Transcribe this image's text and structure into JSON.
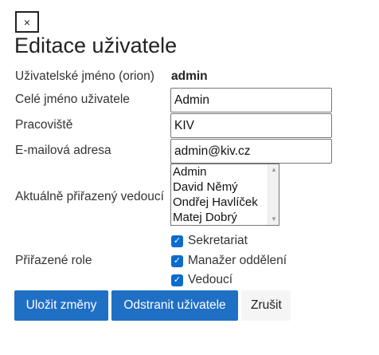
{
  "close_button": {
    "label": "×"
  },
  "page_title": "Editace uživatele",
  "form": {
    "username_label": "Uživatelské jméno (orion)",
    "username_value": "admin",
    "fullname_label": "Celé jméno uživatele",
    "fullname_value": "Admin",
    "workplace_label": "Pracoviště",
    "workplace_value": "KIV",
    "email_label": "E-mailová adresa",
    "email_value": "admin@kiv.cz",
    "supervisor_label": "Aktuálně přiřazený vedoucí",
    "supervisor_options": [
      "Admin",
      "David Němý",
      "Ondřej Havlíček",
      "Matej Dobrý"
    ],
    "roles_label": "Přiřazené role",
    "roles": [
      {
        "label": "Sekretariat",
        "checked": true
      },
      {
        "label": "Manažer oddělení",
        "checked": true
      },
      {
        "label": "Vedoucí",
        "checked": true
      }
    ]
  },
  "buttons": {
    "save": "Uložit změny",
    "delete": "Odstranit uživatele",
    "cancel": "Zrušit"
  },
  "colors": {
    "primary": "#1f6fc5",
    "checkbox": "#0a6ccd"
  }
}
